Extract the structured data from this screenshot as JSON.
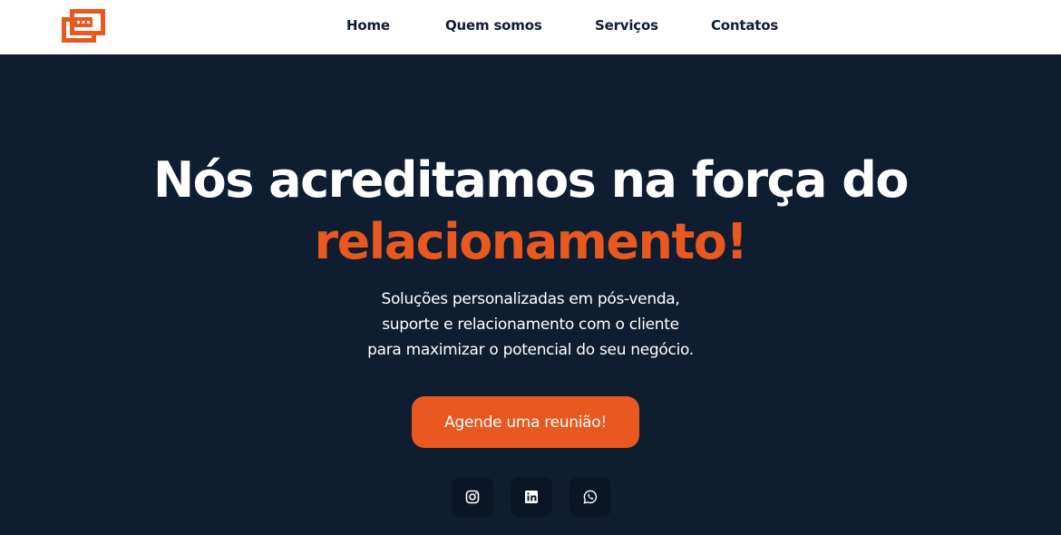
{
  "nav": {
    "items": [
      {
        "label": "Home"
      },
      {
        "label": "Quem somos"
      },
      {
        "label": "Serviços"
      },
      {
        "label": "Contatos"
      }
    ]
  },
  "logo": {
    "icon": "chat-window-icon"
  },
  "hero": {
    "headline_line1": "Nós acreditamos na força do",
    "headline_line2": "relacionamento!",
    "subtitle_lines": [
      "Soluções personalizadas em pós-venda,",
      "suporte e relacionamento com o cliente",
      "para maximizar o potencial do seu negócio."
    ],
    "cta_label": "Agende uma reunião!"
  },
  "social": [
    {
      "icon": "instagram-icon"
    },
    {
      "icon": "linkedin-icon"
    },
    {
      "icon": "whatsapp-icon"
    }
  ],
  "colors": {
    "background": "#0f1d30",
    "accent": "#e8581f",
    "nav_bg": "#ffffff",
    "social_bg": "#0a1626"
  }
}
